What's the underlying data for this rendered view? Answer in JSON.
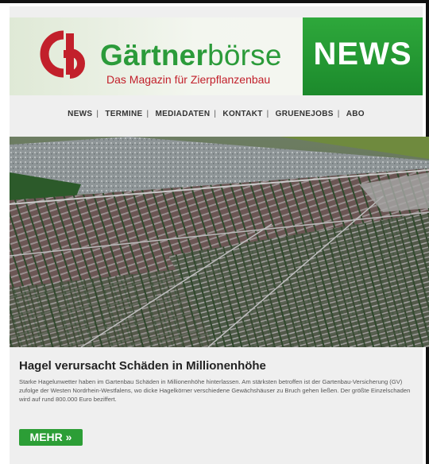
{
  "header": {
    "brand_bold": "Gärtner",
    "brand_light": "börse",
    "tagline": "Das Magazin für Zierpflanzenbau",
    "news_label": "NEWS",
    "logo_icon": "gb-logo-icon",
    "colors": {
      "green": "#2b9b3a",
      "red": "#c2202b"
    }
  },
  "nav": {
    "items": [
      "NEWS",
      "TERMINE",
      "MEDIADATEN",
      "KONTAKT",
      "GRUENEJOBS",
      "ABO"
    ],
    "separator": "|"
  },
  "article": {
    "image_alt": "",
    "headline": "Hagel verursacht Schäden in Millionenhöhe",
    "body": "Starke Hagelunwetter haben im Gartenbau Schäden in Millionenhöhe hinterlassen. Am stärksten betroffen ist der Gartenbau-Versicherung (GV) zufolge der Westen Nordrhein-Westfalens, wo dicke Hagelkörner verschiedene Gewächshäuser zu Bruch gehen ließen. Der größte Einzelschaden wird auf rund 800.000 Euro beziffert.",
    "more_label": "MEHR »"
  }
}
